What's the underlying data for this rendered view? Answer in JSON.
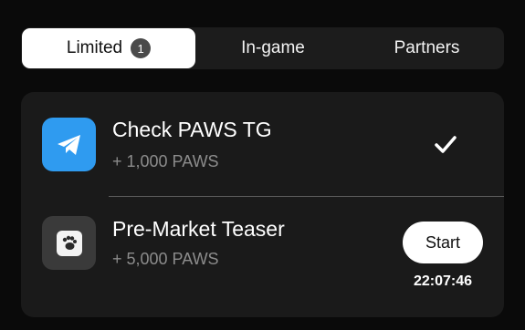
{
  "tabs": [
    {
      "label": "Limited",
      "badge": "1",
      "active": true
    },
    {
      "label": "In-game",
      "active": false
    },
    {
      "label": "Partners",
      "active": false
    }
  ],
  "tasks": [
    {
      "title": "Check PAWS TG",
      "reward": "+ 1,000 PAWS",
      "icon": "telegram-icon",
      "status": "completed",
      "status_icon": "checkmark-icon"
    },
    {
      "title": "Pre-Market Teaser",
      "reward": "+ 5,000 PAWS",
      "icon": "paw-icon",
      "button_label": "Start",
      "timer": "22:07:46"
    }
  ],
  "colors": {
    "background": "#0a0a0a",
    "tab_bar": "#1c1c1c",
    "card": "#1a1a1a",
    "telegram_blue": "#2f9bf0",
    "muted_text": "#8c8c8c"
  }
}
